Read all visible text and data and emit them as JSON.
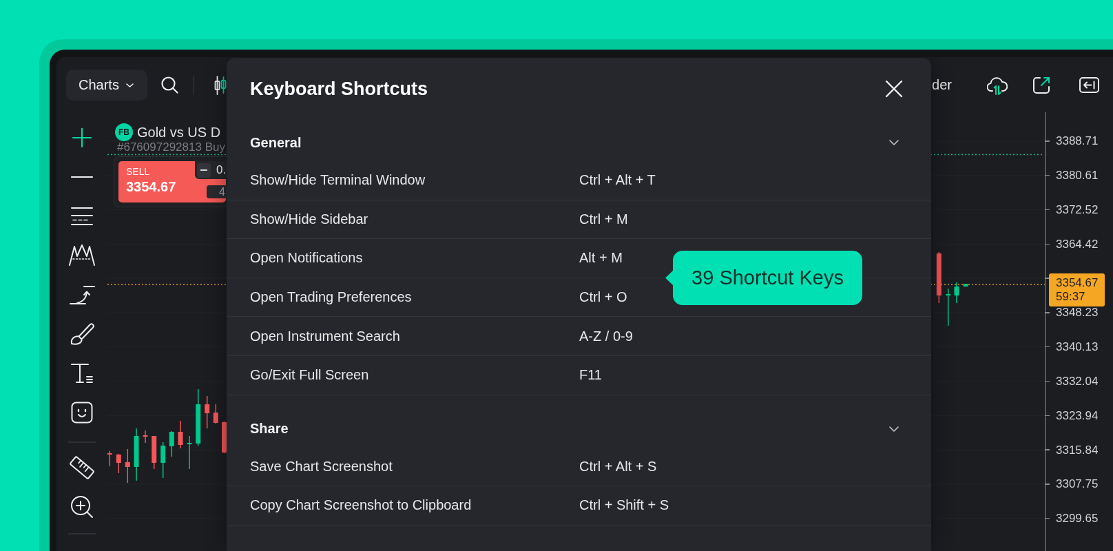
{
  "toolbar": {
    "menu_label": "Charts",
    "cut_label": "der"
  },
  "chart": {
    "badge": "FB",
    "title": "Gold vs US D",
    "subtitle": "#676097292813 Buy",
    "trade_panel": {
      "side": "SELL",
      "price": "3354.67",
      "volume": "0.",
      "amount": "4"
    }
  },
  "price_axis": [
    {
      "kind": "tick",
      "label": "3388.71"
    },
    {
      "kind": "tick",
      "label": "3380.61"
    },
    {
      "kind": "tick",
      "label": "3372.52"
    },
    {
      "kind": "tick",
      "label": "3364.42"
    },
    {
      "kind": "current",
      "price": "3354.67",
      "countdown": "59:37"
    },
    {
      "kind": "tick",
      "label": "3348.23"
    },
    {
      "kind": "tick",
      "label": "3340.13"
    },
    {
      "kind": "tick",
      "label": "3332.04"
    },
    {
      "kind": "tick",
      "label": "3323.94"
    },
    {
      "kind": "tick",
      "label": "3315.84"
    },
    {
      "kind": "tick",
      "label": "3307.75"
    },
    {
      "kind": "tick",
      "label": "3299.65"
    }
  ],
  "dialog": {
    "title": "Keyboard Shortcuts",
    "sections": [
      {
        "title": "General",
        "expanded": true,
        "shortcuts": [
          {
            "action": "Show/Hide Terminal Window",
            "keys": "Ctrl + Alt + T"
          },
          {
            "action": "Show/Hide Sidebar",
            "keys": "Ctrl + M"
          },
          {
            "action": "Open Notifications",
            "keys": "Alt + M"
          },
          {
            "action": "Open Trading Preferences",
            "keys": "Ctrl + O"
          },
          {
            "action": "Open Instrument Search",
            "keys": "A-Z / 0-9"
          },
          {
            "action": "Go/Exit Full Screen",
            "keys": "F11"
          }
        ]
      },
      {
        "title": "Share",
        "expanded": true,
        "shortcuts": [
          {
            "action": "Save Chart Screenshot",
            "keys": "Ctrl + Alt + S"
          },
          {
            "action": "Copy Chart Screenshot to Clipboard",
            "keys": "Ctrl + Shift + S"
          }
        ]
      }
    ]
  },
  "tooltip": {
    "text": "39 Shortcut Keys"
  }
}
